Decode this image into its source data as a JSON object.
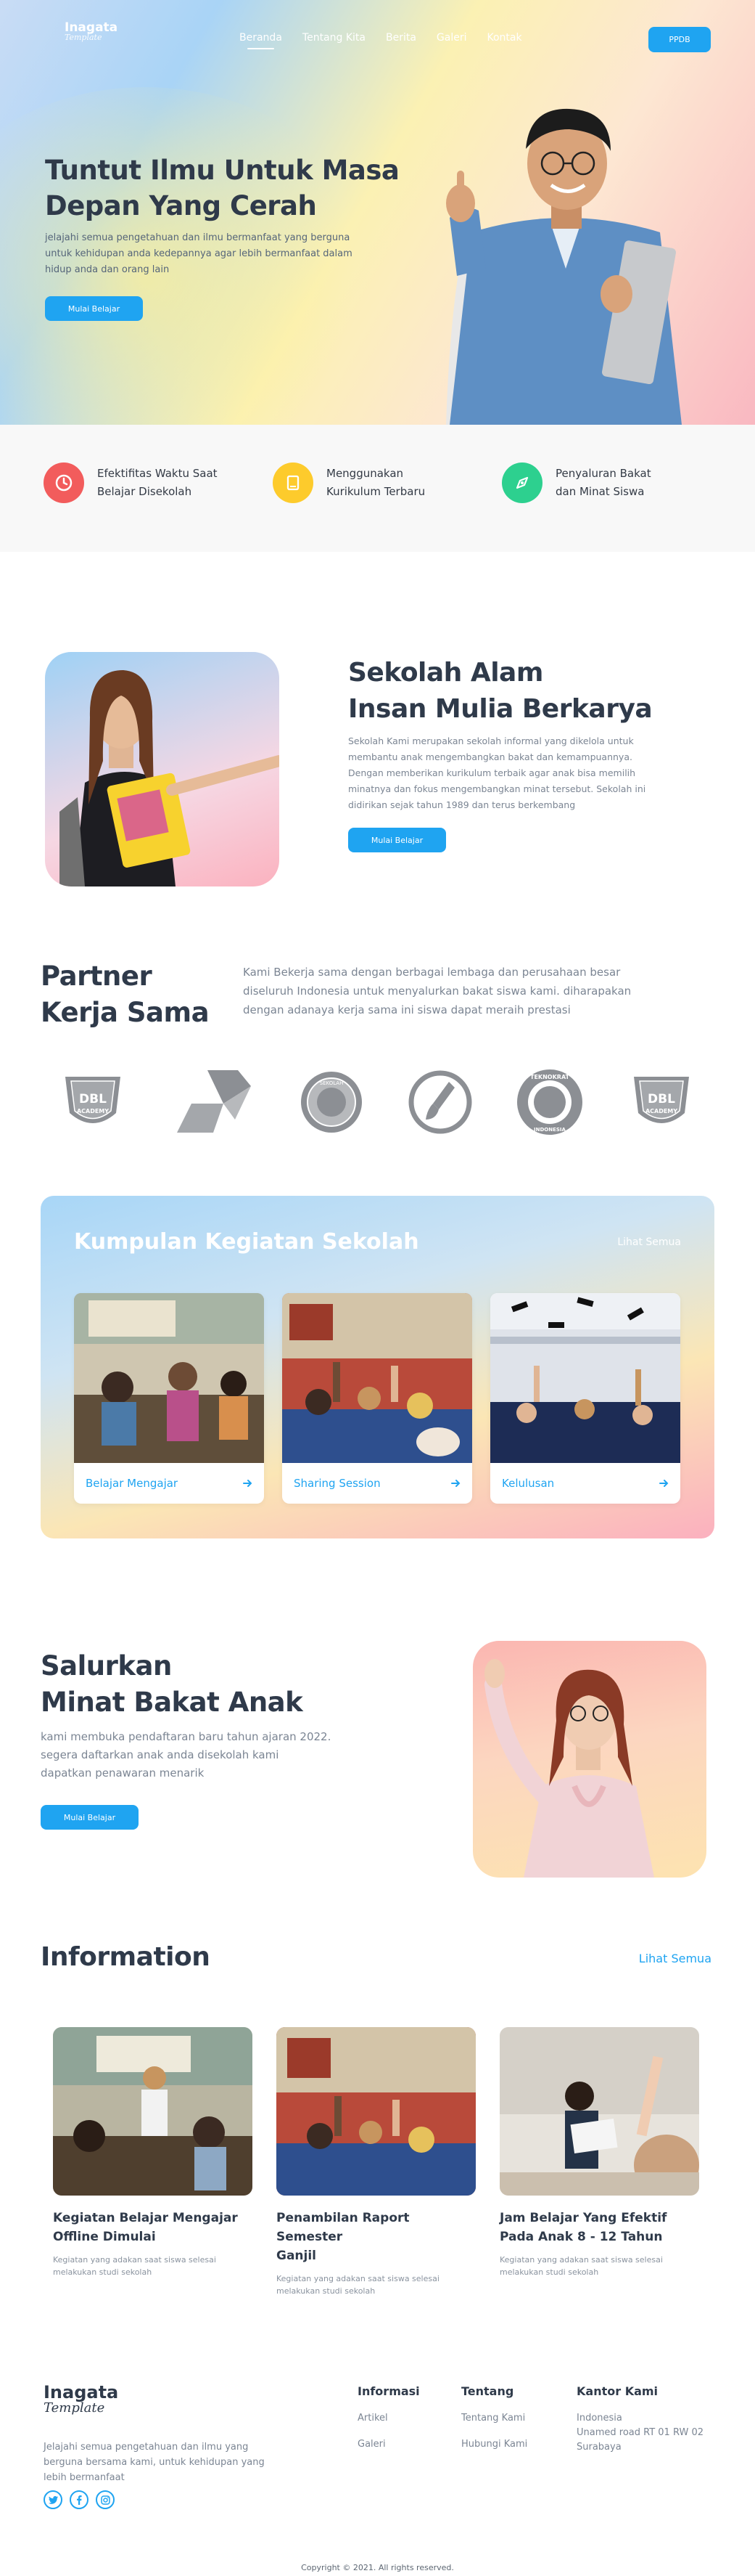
{
  "brand": {
    "name": "Inagata",
    "tagline": "Template"
  },
  "nav": {
    "items": [
      "Beranda",
      "Tentang Kita",
      "Berita",
      "Galeri",
      "Kontak"
    ],
    "cta": "PPDB"
  },
  "hero": {
    "title_line1": "Tuntut Ilmu Untuk Masa",
    "title_line2": "Depan Yang Cerah",
    "desc_line1": "jelajahi  semua pengetahuan dan ilmu bermanfaat yang berguna",
    "desc_line2": "untuk kehidupan anda kedepannya agar lebih bermanfaat dalam",
    "desc_line3": "hidup anda dan orang lain",
    "cta": "Mulai Belajar"
  },
  "features": [
    {
      "icon": "clock-icon",
      "line1": "Efektifitas Waktu Saat",
      "line2": "Belajar Disekolah",
      "color": "#f25c5c"
    },
    {
      "icon": "book-icon",
      "line1": "Menggunakan",
      "line2": "Kurikulum Terbaru",
      "color": "#fdcb2c"
    },
    {
      "icon": "pen-tool-icon",
      "line1": "Penyaluran Bakat",
      "line2": "dan Minat Siswa",
      "color": "#2dd08f"
    }
  ],
  "about": {
    "title_line1": "Sekolah Alam",
    "title_line2": "Insan Mulia Berkarya",
    "desc": [
      "Sekolah Kami merupakan sekolah informal yang dikelola untuk",
      "membantu anak mengembangkan bakat dan kemampuannya.",
      "Dengan memberikan kurikulum terbaik agar anak bisa memilih",
      "minatnya dan fokus mengembangkan minat tersebut. Sekolah ini",
      "didirikan sejak tahun 1989 dan terus berkembang"
    ],
    "cta": "Mulai Belajar"
  },
  "partner": {
    "title_line1": "Partner",
    "title_line2": "Kerja Sama",
    "desc": [
      "Kami Bekerja sama dengan berbagai lembaga dan perusahaan besar",
      "diseluruh Indonesia untuk menyalurkan bakat siswa kami. diharapakan",
      "dengan adanaya kerja sama ini siswa dapat meraih prestasi"
    ],
    "logos": [
      {
        "icon": "dbl-academy-logo",
        "text1": "DBL",
        "text2": "ACADEMY"
      },
      {
        "icon": "pertamina-logo"
      },
      {
        "icon": "school-seal-logo",
        "text1": "SEKOLAH"
      },
      {
        "icon": "brush-logo"
      },
      {
        "icon": "teknokrat-seal-logo",
        "text1": "TEKNOKRAT",
        "text2": "INDONESIA"
      },
      {
        "icon": "dbl-academy-logo-2",
        "text1": "DBL",
        "text2": "ACADEMY"
      }
    ]
  },
  "kegiatan": {
    "title": "Kumpulan Kegiatan Sekolah",
    "see_all": "Lihat Semua",
    "cards": [
      {
        "label": "Belajar Mengajar"
      },
      {
        "label": "Sharing Session"
      },
      {
        "label": "Kelulusan"
      }
    ]
  },
  "bakat": {
    "title_line1": "Salurkan",
    "title_line2": "Minat Bakat Anak",
    "desc": [
      "kami membuka pendaftaran baru tahun ajaran 2022.",
      "segera daftarkan anak anda disekolah kami",
      "dapatkan penawaran menarik"
    ],
    "cta": "Mulai Belajar"
  },
  "information": {
    "title": "Information",
    "see_all": "Lihat Semua",
    "items": [
      {
        "title1": "Kegiatan Belajar Mengajar",
        "title2": "Offline Dimulai",
        "desc1": "Kegiatan yang adakan saat siswa selesai",
        "desc2": "melakukan studi sekolah"
      },
      {
        "title1": "Penambilan Raport Semester",
        "title2": "Ganjil",
        "desc1": "Kegiatan yang adakan saat siswa selesai",
        "desc2": "melakukan studi sekolah"
      },
      {
        "title1": "Jam Belajar Yang Efektif",
        "title2": "Pada Anak 8 - 12 Tahun",
        "desc1": "Kegiatan yang adakan saat siswa selesai",
        "desc2": "melakukan studi sekolah"
      }
    ]
  },
  "footer": {
    "brand": "Inagata",
    "tagline": "Template",
    "desc": [
      "Jelajahi semua pengetahuan dan ilmu yang",
      "berguna bersama kami, untuk kehidupan yang",
      "lebih bermanfaat"
    ],
    "social": [
      "twitter-icon",
      "facebook-icon",
      "instagram-icon"
    ],
    "informasi": {
      "head": "Informasi",
      "links": [
        "Artikel",
        "Galeri"
      ]
    },
    "tentang": {
      "head": "Tentang",
      "links": [
        "Tentang Kami",
        "Hubungi Kami"
      ]
    },
    "kantor": {
      "head": "Kantor Kami",
      "lines": [
        "Indonesia",
        "Unamed road RT 01 RW 02",
        "Surabaya"
      ]
    },
    "copyright": "Copyright © 2021. All rights reserved."
  },
  "colors": {
    "accent": "#1fa4f1",
    "text_dark": "#2f3a4a",
    "text_muted": "#7b8593"
  }
}
